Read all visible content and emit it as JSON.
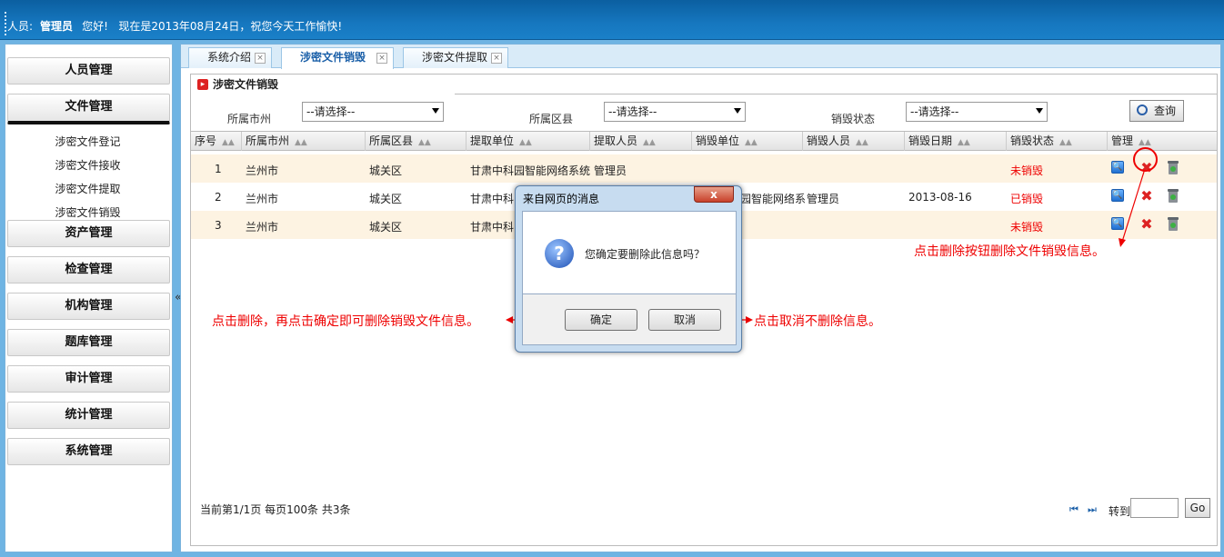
{
  "header": {
    "user_label": "人员:",
    "user_name": "管理员",
    "greeting": "您好!",
    "date_text": "现在是2013年08月24日，祝您今天工作愉快!"
  },
  "sidebar": {
    "items": [
      {
        "label": "人员管理"
      },
      {
        "label": "文件管理"
      },
      {
        "label": "资产管理"
      },
      {
        "label": "检查管理"
      },
      {
        "label": "机构管理"
      },
      {
        "label": "题库管理"
      },
      {
        "label": "审计管理"
      },
      {
        "label": "统计管理"
      },
      {
        "label": "系统管理"
      }
    ],
    "sub_items": [
      "涉密文件登记",
      "涉密文件接收",
      "涉密文件提取",
      "涉密文件销毁"
    ],
    "collapse_glyph": "«"
  },
  "tabs": [
    {
      "label": "系统介绍"
    },
    {
      "label": "涉密文件销毁"
    },
    {
      "label": "涉密文件提取"
    }
  ],
  "panel": {
    "title": "涉密文件销毁"
  },
  "filters": {
    "city_label": "所属市州",
    "city_value": "--请选择--",
    "county_label": "所属区县",
    "county_value": "--请选择--",
    "status_label": "销毁状态",
    "status_value": "--请选择--",
    "query_label": "查询"
  },
  "table": {
    "headers": [
      "序号",
      "所属市州",
      "所属区县",
      "提取单位",
      "提取人员",
      "销毁单位",
      "销毁人员",
      "销毁日期",
      "销毁状态",
      "管理"
    ],
    "rows": [
      {
        "no": "1",
        "city": "兰州市",
        "county": "城关区",
        "unit": "甘肃中科园智能网络系统",
        "person": "管理员",
        "d_unit": "",
        "d_person": "",
        "date": "",
        "status": "未销毁"
      },
      {
        "no": "2",
        "city": "兰州市",
        "county": "城关区",
        "unit": "甘肃中科",
        "person": "",
        "d_unit": "园智能网络系",
        "d_person": "管理员",
        "date": "2013-08-16",
        "status": "已销毁"
      },
      {
        "no": "3",
        "city": "兰州市",
        "county": "城关区",
        "unit": "甘肃中科",
        "person": "",
        "d_unit": "",
        "d_person": "",
        "date": "",
        "status": "未销毁"
      }
    ]
  },
  "footer": {
    "page_info": "当前第1/1页 每页100条 共3条",
    "first_glyph": "⏮",
    "last_glyph": "⏭",
    "goto_label": "转到",
    "go_label": "Go"
  },
  "dialog": {
    "title": "来自网页的消息",
    "close_glyph": "x",
    "message": "您确定要删除此信息吗？",
    "ok_label": "确定",
    "cancel_label": "取消"
  },
  "annotations": {
    "delete_hint": "点击删除按钮删除文件销毁信息。",
    "confirm_hint": "点击删除，再点击确定即可删除销毁文件信息。",
    "cancel_hint": "点击取消不删除信息。"
  },
  "colors": {
    "accent": "#1a80c8",
    "status_red": "#ee0000",
    "annotation": "#ee0000"
  }
}
